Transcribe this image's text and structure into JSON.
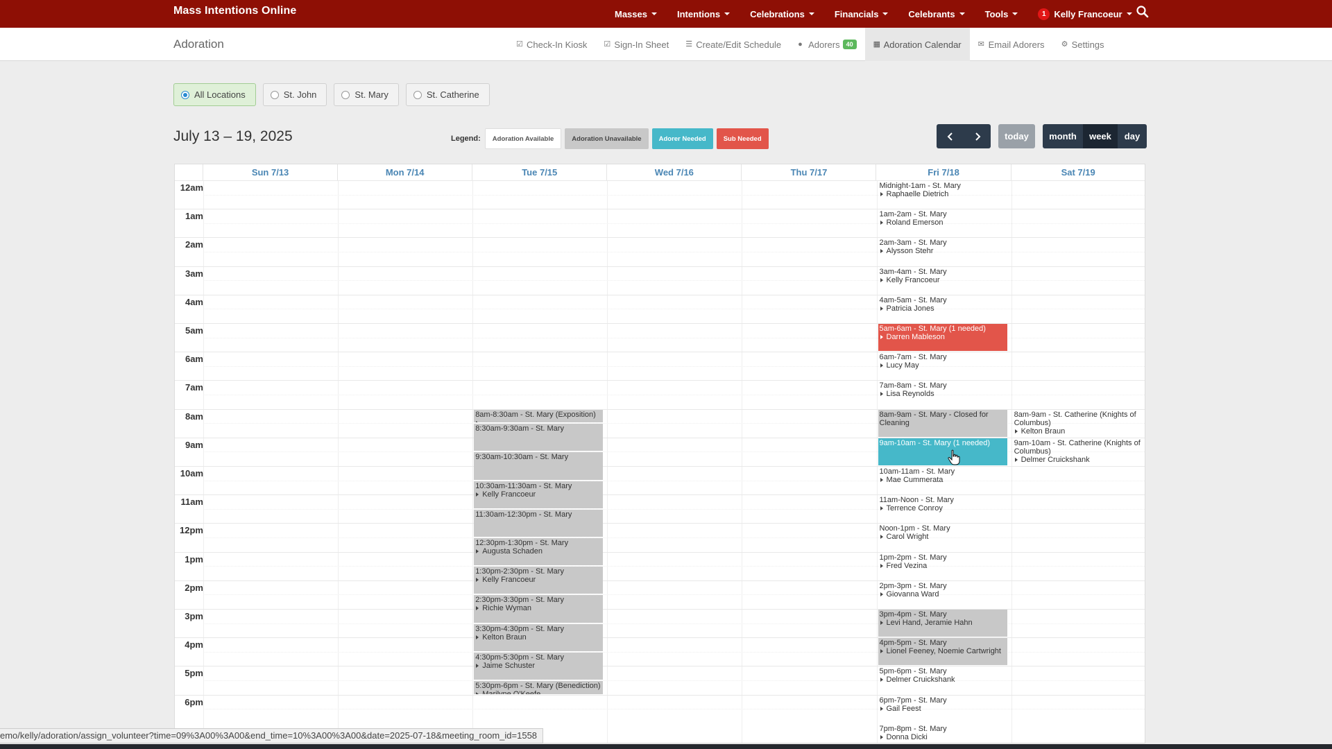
{
  "nav": {
    "brand": "Mass Intentions Online",
    "items": [
      {
        "label": "Masses"
      },
      {
        "label": "Intentions"
      },
      {
        "label": "Celebrations"
      },
      {
        "label": "Financials"
      },
      {
        "label": "Celebrants"
      },
      {
        "label": "Tools"
      }
    ],
    "user": {
      "notifications": "1",
      "name": "Kelly Francoeur"
    }
  },
  "subnav": {
    "title": "Adoration",
    "items": [
      {
        "label": "Check-In Kiosk",
        "icon": "check-square-icon"
      },
      {
        "label": "Sign-In Sheet",
        "icon": "check-square-icon"
      },
      {
        "label": "Create/Edit Schedule",
        "icon": "list-icon"
      },
      {
        "label": "Adorers",
        "icon": "user-icon",
        "badge": "40"
      },
      {
        "label": "Adoration Calendar",
        "icon": "calendar-icon",
        "active": true
      },
      {
        "label": "Email Adorers",
        "icon": "envelope-icon"
      },
      {
        "label": "Settings",
        "icon": "gear-icon"
      }
    ]
  },
  "locations": [
    {
      "label": "All Locations",
      "selected": true
    },
    {
      "label": "St. John",
      "selected": false
    },
    {
      "label": "St. Mary",
      "selected": false
    },
    {
      "label": "St. Catherine",
      "selected": false
    }
  ],
  "range": "July 13 – 19, 2025",
  "legend": {
    "label": "Legend:",
    "items": [
      {
        "label": "Adoration Available",
        "bg": "#ffffff",
        "fg": "#555555"
      },
      {
        "label": "Adoration Unavailable",
        "bg": "#c8c8c8",
        "fg": "#444444"
      },
      {
        "label": "Adorer Needed",
        "bg": "#46b8c9",
        "fg": "#ffffff"
      },
      {
        "label": "Sub Needed",
        "bg": "#e2554a",
        "fg": "#ffffff"
      }
    ]
  },
  "buttons": {
    "today": "today",
    "month": "month",
    "week": "week",
    "day": "day"
  },
  "days": [
    "Sun 7/13",
    "Mon 7/14",
    "Tue 7/15",
    "Wed 7/16",
    "Thu 7/17",
    "Fri 7/18",
    "Sat 7/19"
  ],
  "hours": [
    "12am",
    "1am",
    "2am",
    "3am",
    "4am",
    "5am",
    "6am",
    "7am",
    "8am",
    "9am",
    "10am",
    "11am",
    "12pm",
    "1pm",
    "2pm",
    "3pm",
    "4pm",
    "5pm",
    "6pm"
  ],
  "events": [
    {
      "day": 2,
      "start": 8,
      "end": 8.5,
      "title": "8am-8:30am - St. Mary (Exposition)",
      "names": [
        "- "
      ],
      "kind": "gray"
    },
    {
      "day": 2,
      "start": 8.5,
      "end": 9.5,
      "title": "8:30am-9:30am - St. Mary",
      "names": [],
      "kind": "gray"
    },
    {
      "day": 2,
      "start": 9.5,
      "end": 10.5,
      "title": "9:30am-10:30am - St. Mary",
      "names": [],
      "kind": "gray"
    },
    {
      "day": 2,
      "start": 10.5,
      "end": 11.5,
      "title": "10:30am-11:30am - St. Mary",
      "names": [
        "Kelly Francoeur"
      ],
      "kind": "gray"
    },
    {
      "day": 2,
      "start": 11.5,
      "end": 12.5,
      "title": "11:30am-12:30pm - St. Mary",
      "names": [],
      "kind": "gray"
    },
    {
      "day": 2,
      "start": 12.5,
      "end": 13.5,
      "title": "12:30pm-1:30pm - St. Mary",
      "names": [
        "Augusta Schaden"
      ],
      "kind": "gray"
    },
    {
      "day": 2,
      "start": 13.5,
      "end": 14.5,
      "title": "1:30pm-2:30pm - St. Mary",
      "names": [
        "Kelly Francoeur"
      ],
      "kind": "gray"
    },
    {
      "day": 2,
      "start": 14.5,
      "end": 15.5,
      "title": "2:30pm-3:30pm - St. Mary",
      "names": [
        "Richie Wyman"
      ],
      "kind": "gray"
    },
    {
      "day": 2,
      "start": 15.5,
      "end": 16.5,
      "title": "3:30pm-4:30pm - St. Mary",
      "names": [
        "Kelton Braun"
      ],
      "kind": "gray"
    },
    {
      "day": 2,
      "start": 16.5,
      "end": 17.5,
      "title": "4:30pm-5:30pm - St. Mary",
      "names": [
        "Jaime Schuster"
      ],
      "kind": "gray"
    },
    {
      "day": 2,
      "start": 17.5,
      "end": 18,
      "title": "5:30pm-6pm - St. Mary (Benediction)",
      "names": [
        "Marilyne O'Keefe"
      ],
      "kind": "gray"
    },
    {
      "day": 5,
      "start": 0,
      "end": 1,
      "title": "Midnight-1am - St. Mary",
      "names": [
        "Raphaelle Dietrich"
      ],
      "kind": "plain"
    },
    {
      "day": 5,
      "start": 1,
      "end": 2,
      "title": "1am-2am - St. Mary",
      "names": [
        "Roland Emerson"
      ],
      "kind": "plain"
    },
    {
      "day": 5,
      "start": 2,
      "end": 3,
      "title": "2am-3am - St. Mary",
      "names": [
        "Alysson Stehr"
      ],
      "kind": "plain"
    },
    {
      "day": 5,
      "start": 3,
      "end": 4,
      "title": "3am-4am - St. Mary",
      "names": [
        "Kelly Francoeur"
      ],
      "kind": "plain"
    },
    {
      "day": 5,
      "start": 4,
      "end": 5,
      "title": "4am-5am - St. Mary",
      "names": [
        "Patricia Jones"
      ],
      "kind": "plain"
    },
    {
      "day": 5,
      "start": 5,
      "end": 6,
      "title": "5am-6am - St. Mary (1 needed)",
      "names": [
        "Darren Mableson"
      ],
      "kind": "red"
    },
    {
      "day": 5,
      "start": 6,
      "end": 7,
      "title": "6am-7am - St. Mary",
      "names": [
        "Lucy May"
      ],
      "kind": "plain"
    },
    {
      "day": 5,
      "start": 7,
      "end": 8,
      "title": "7am-8am - St. Mary",
      "names": [
        "Lisa Reynolds"
      ],
      "kind": "plain"
    },
    {
      "day": 5,
      "start": 8,
      "end": 9,
      "title": "8am-9am - St. Mary - Closed for Cleaning",
      "names": [],
      "kind": "gray"
    },
    {
      "day": 5,
      "start": 9,
      "end": 10,
      "title": "9am-10am - St. Mary (1 needed)",
      "names": [],
      "kind": "teal"
    },
    {
      "day": 5,
      "start": 10,
      "end": 11,
      "title": "10am-11am - St. Mary",
      "names": [
        "Mae Cummerata"
      ],
      "kind": "plain"
    },
    {
      "day": 5,
      "start": 11,
      "end": 12,
      "title": "11am-Noon - St. Mary",
      "names": [
        "Terrence Conroy"
      ],
      "kind": "plain"
    },
    {
      "day": 5,
      "start": 12,
      "end": 13,
      "title": "Noon-1pm - St. Mary",
      "names": [
        "Carol Wright"
      ],
      "kind": "plain"
    },
    {
      "day": 5,
      "start": 13,
      "end": 14,
      "title": "1pm-2pm - St. Mary",
      "names": [
        "Fred Vezina"
      ],
      "kind": "plain"
    },
    {
      "day": 5,
      "start": 14,
      "end": 15,
      "title": "2pm-3pm - St. Mary",
      "names": [
        "Giovanna Ward"
      ],
      "kind": "plain"
    },
    {
      "day": 5,
      "start": 15,
      "end": 16,
      "title": "3pm-4pm - St. Mary",
      "names": [
        "Levi Hand, Jeramie Hahn"
      ],
      "kind": "gray"
    },
    {
      "day": 5,
      "start": 16,
      "end": 17,
      "title": "4pm-5pm - St. Mary",
      "names": [
        "Lionel Feeney, Noemie Cartwright"
      ],
      "kind": "gray"
    },
    {
      "day": 5,
      "start": 17,
      "end": 18,
      "title": "5pm-6pm - St. Mary",
      "names": [
        "Delmer Cruickshank"
      ],
      "kind": "plain"
    },
    {
      "day": 5,
      "start": 18,
      "end": 19,
      "title": "6pm-7pm - St. Mary",
      "names": [
        "Gail Feest"
      ],
      "kind": "plain"
    },
    {
      "day": 5,
      "start": 19,
      "end": 20,
      "title": "7pm-8pm - St. Mary",
      "names": [
        "Donna Dicki"
      ],
      "kind": "plain"
    },
    {
      "day": 6,
      "start": 8,
      "end": 9,
      "title": "8am-9am - St. Catherine (Knights of Columbus)",
      "names": [
        "Kelton Braun"
      ],
      "kind": "plain"
    },
    {
      "day": 6,
      "start": 9,
      "end": 10,
      "title": "9am-10am - St. Catherine (Knights of Columbus)",
      "names": [
        "Delmer Cruickshank"
      ],
      "kind": "plain"
    }
  ],
  "status_url": "emo/kelly/adoration/assign_volunteer?time=09%3A00%3A00&end_time=10%3A00%3A00&date=2025-07-18&meeting_room_id=1558",
  "colors": {
    "navbar": "#8e0f05",
    "gray_event": "#c8c8c8",
    "sub_needed": "#e2554a",
    "adorer_needed": "#46b8c9",
    "nav_dark": "#2d3b4b"
  }
}
